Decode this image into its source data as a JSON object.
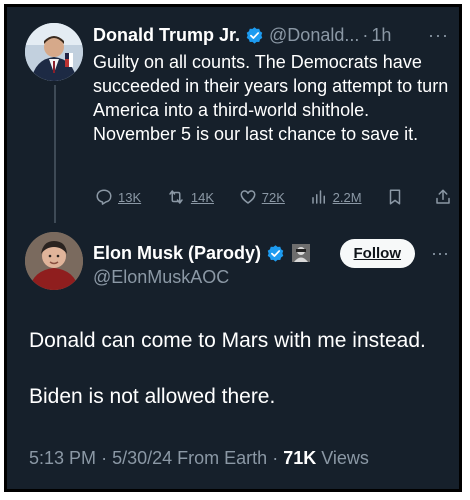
{
  "tweet1": {
    "display_name": "Donald Trump Jr.",
    "handle": "@Donald...",
    "separator": "·",
    "time": "1h",
    "text": "Guilty on all counts. The Democrats have succeeded in their years long attempt to turn America into a third-world shithole. November 5 is our last chance to save it.",
    "replies": "13K",
    "retweets": "14K",
    "likes": "72K",
    "views": "2.2M",
    "more": "···"
  },
  "tweet2": {
    "display_name": "Elon Musk (Parody)",
    "handle": "@ElonMuskAOC",
    "follow_label": "Follow",
    "more": "···",
    "text_lines": [
      "Donald can come to Mars with me instead.",
      "Biden is not allowed there."
    ],
    "time": "5:13 PM",
    "date": "5/30/24",
    "source": "From Earth",
    "views_count": "71K",
    "views_label": "Views"
  },
  "colors": {
    "background": "#16202b",
    "text": "#ffffff",
    "secondary": "#8b98a5",
    "verified": "#1d9bf0"
  }
}
